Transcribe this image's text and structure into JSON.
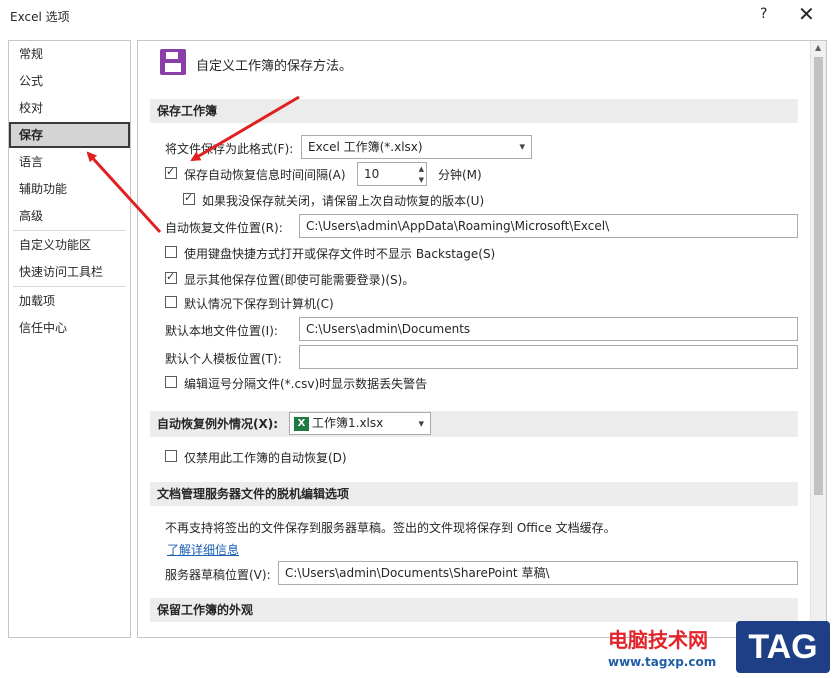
{
  "window": {
    "title": "Excel 选项",
    "help": "?",
    "close": "✕"
  },
  "nav": {
    "items": [
      "常规",
      "公式",
      "校对",
      "保存",
      "语言",
      "辅助功能",
      "高级",
      "自定义功能区",
      "快速访问工具栏",
      "加载项",
      "信任中心"
    ],
    "active_index": 3
  },
  "panel": {
    "heading": "自定义工作簿的保存方法。",
    "save_section": {
      "title": "保存工作簿",
      "format_label": "将文件保存为此格式(F):",
      "format_value": "Excel 工作簿(*.xlsx)",
      "autorecover_label": "保存自动恢复信息时间间隔(A)",
      "autorecover_checked": true,
      "interval_value": "10",
      "interval_unit": "分钟(M)",
      "keep_last_label": "如果我没保存就关闭，请保留上次自动恢复的版本(U)",
      "keep_last_checked": true,
      "autorecover_location_label": "自动恢复文件位置(R):",
      "autorecover_location_value": "C:\\Users\\admin\\AppData\\Roaming\\Microsoft\\Excel\\",
      "no_backstage_label": "使用键盘快捷方式打开或保存文件时不显示 Backstage(S)",
      "no_backstage_checked": false,
      "show_extra_label": "显示其他保存位置(即使可能需要登录)(S)。",
      "show_extra_checked": true,
      "default_computer_label": "默认情况下保存到计算机(C)",
      "default_computer_checked": false,
      "default_local_label": "默认本地文件位置(I):",
      "default_local_value": "C:\\Users\\admin\\Documents",
      "default_template_label": "默认个人模板位置(T):",
      "default_template_value": "",
      "csv_warning_label": "编辑逗号分隔文件(*.csv)时显示数据丢失警告",
      "csv_warning_checked": false
    },
    "autorecover_exceptions": {
      "label": "自动恢复例外情况(X):",
      "workbook_value": "工作簿1.xlsx",
      "disable_label": "仅禁用此工作簿的自动恢复(D)",
      "disable_checked": false
    },
    "offline_section": {
      "title": "文档管理服务器文件的脱机编辑选项",
      "notice": "不再支持将签出的文件保存到服务器草稿。签出的文件现将保存到 Office 文档缓存。",
      "learn_more": "了解详细信息",
      "drafts_label": "服务器草稿位置(V):",
      "drafts_value": "C:\\Users\\admin\\Documents\\SharePoint 草稿\\"
    },
    "appearance_section": {
      "title": "保留工作簿的外观"
    }
  },
  "watermark": {
    "site_name": "电脑技术网",
    "url": "www.tagxp.com",
    "badge": "TAG"
  },
  "colors": {
    "accent_arrow": "#e02020",
    "save_icon": "#8a3ea8",
    "link": "#1a5fb4"
  }
}
